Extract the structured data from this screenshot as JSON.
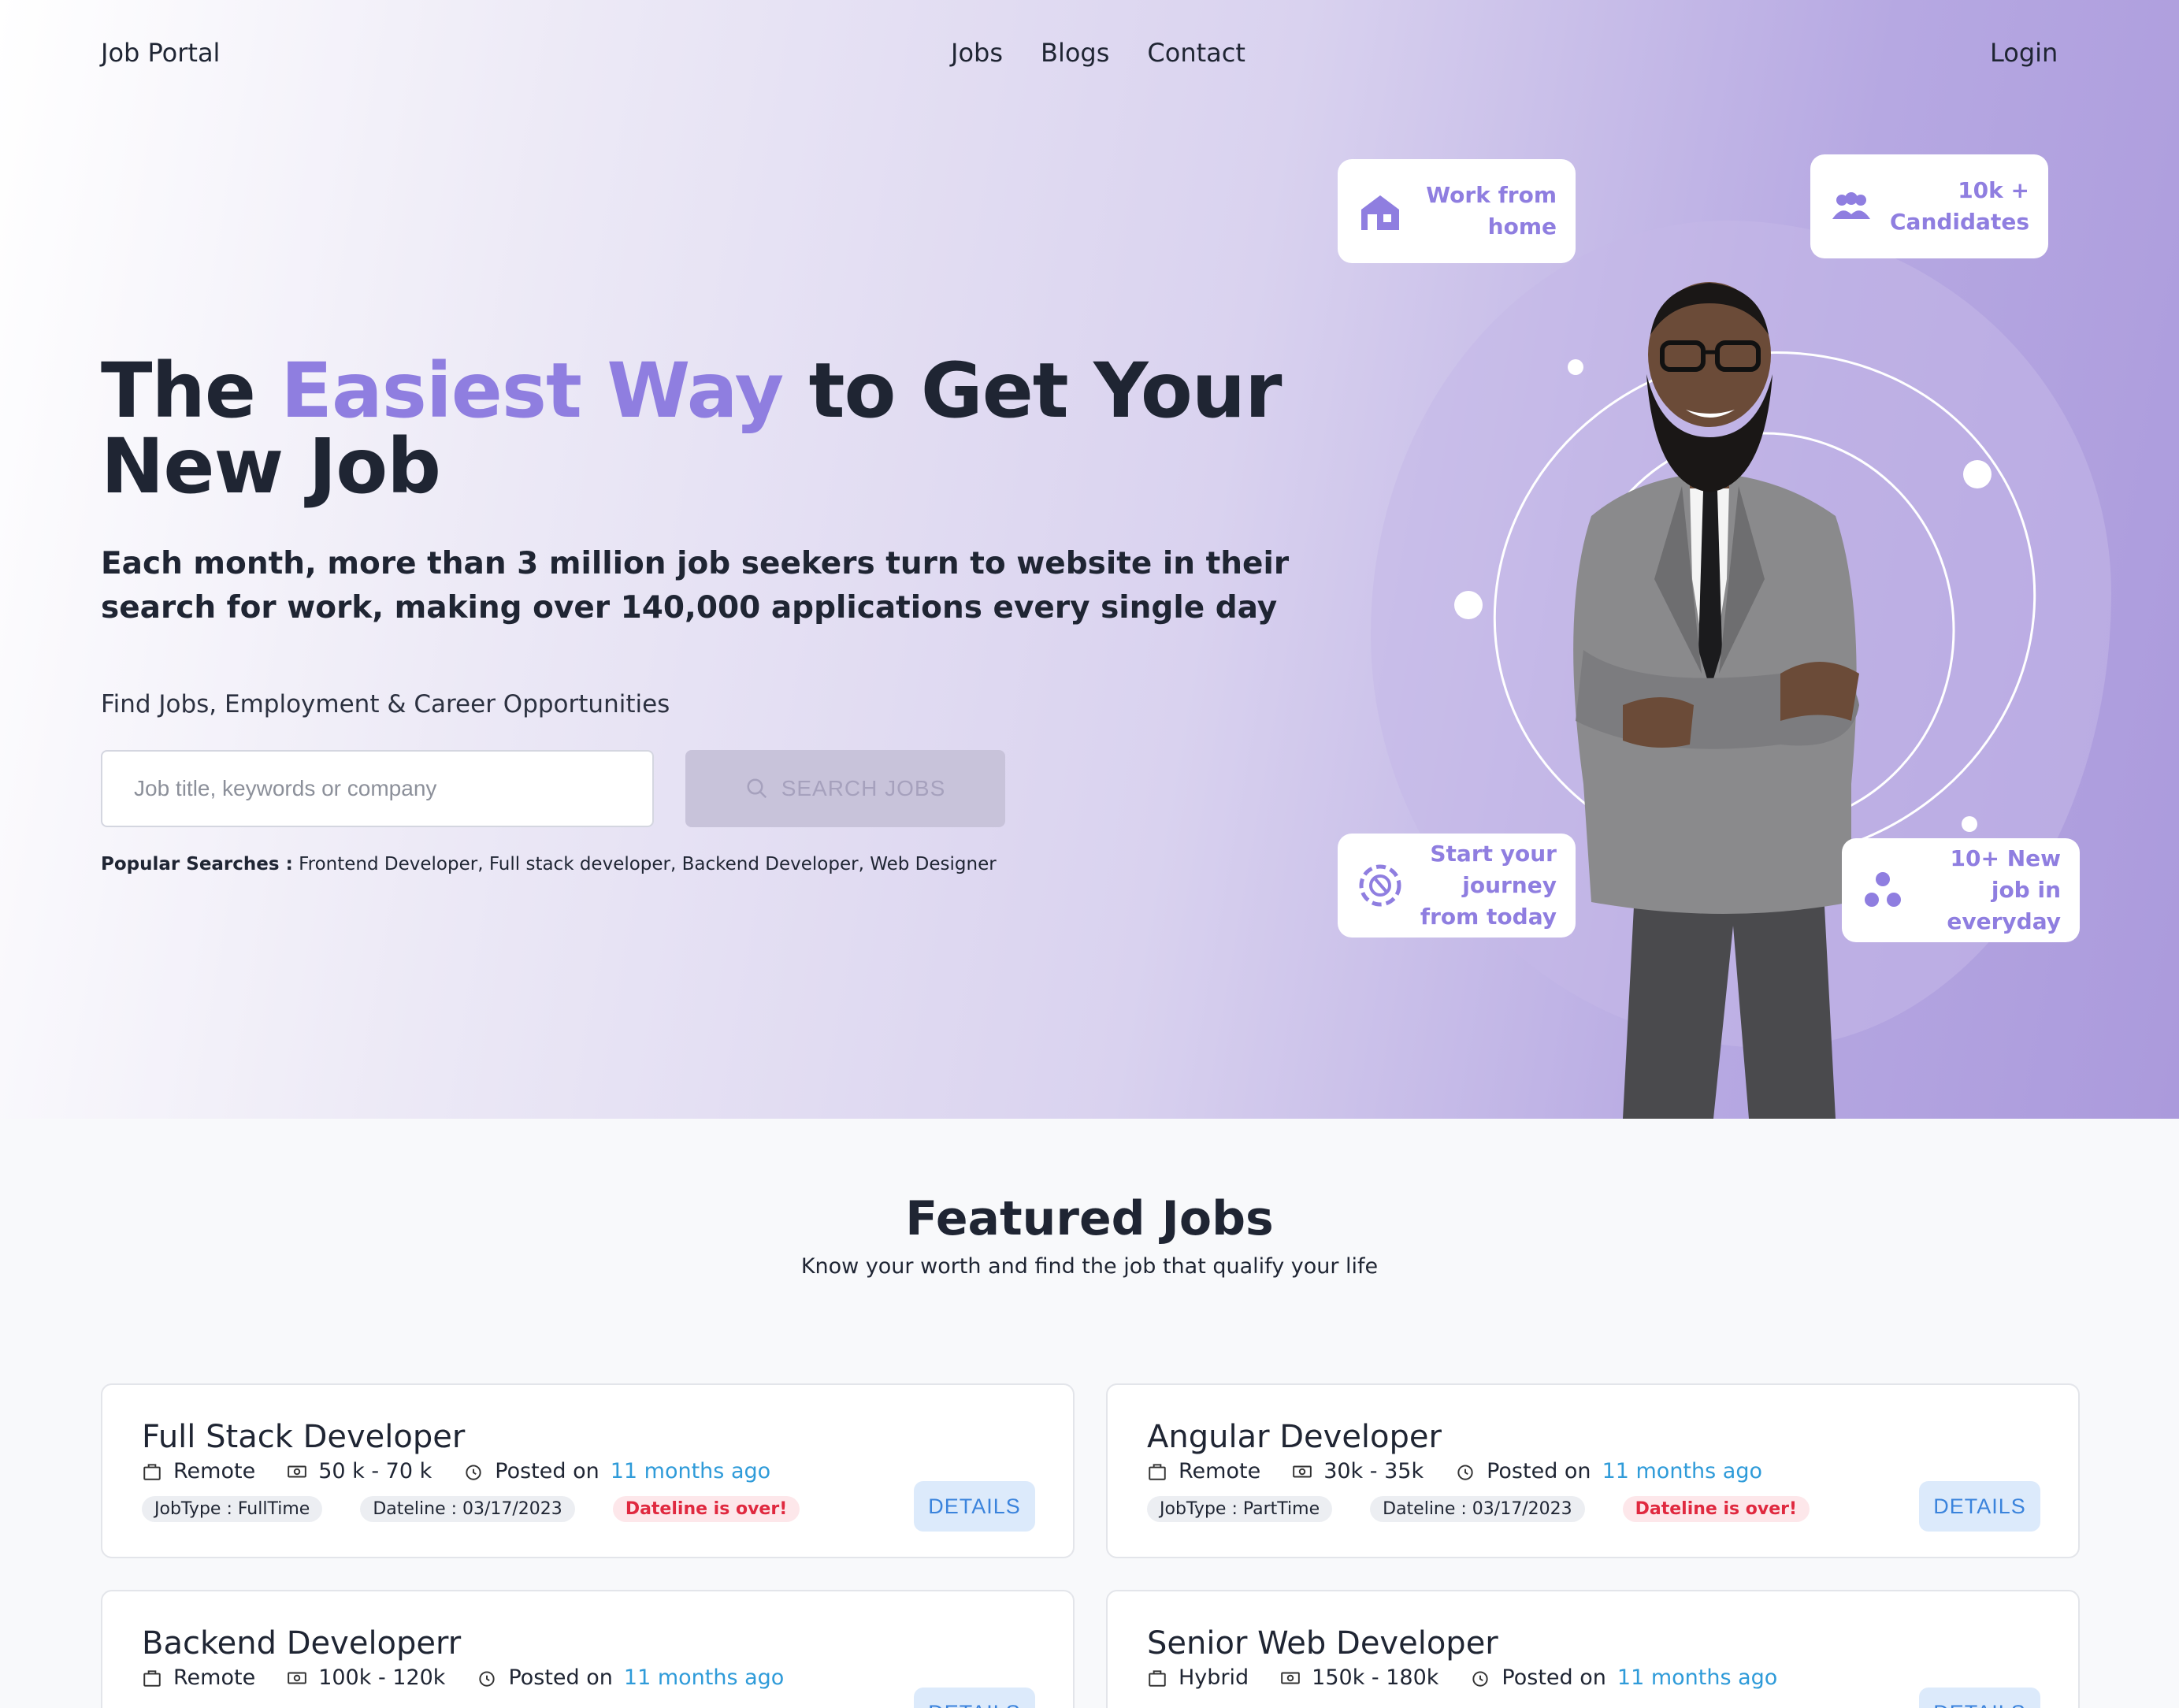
{
  "nav": {
    "brand": "Job Portal",
    "links": [
      "Jobs",
      "Blogs",
      "Contact"
    ],
    "login": "Login"
  },
  "hero": {
    "headline_pre": "The ",
    "headline_accent": "Easiest Way",
    "headline_post": " to Get Your New Job",
    "subhead": "Each month, more than 3 million job seekers turn to website in their search for work, making over 140,000 applications every single day",
    "find_label": "Find Jobs, Employment & Career Opportunities",
    "search_placeholder": "Job title, keywords or company",
    "search_button": "SEARCH JOBS",
    "popular_label": "Popular Searches :",
    "popular_items": " Frontend Developer, Full stack developer, Backend Developer, Web Designer"
  },
  "float_cards": {
    "work_from_home": [
      "Work from",
      "home"
    ],
    "candidates": [
      "10k +",
      "Candidates"
    ],
    "start_journey": [
      "Start your",
      "journey",
      "from today"
    ],
    "new_jobs": [
      "10+ New",
      "job in",
      "everyday"
    ]
  },
  "featured": {
    "title": "Featured Jobs",
    "subtitle": "Know your worth and find the job that qualify your life",
    "details_label": "DETAILS",
    "posted_label": "Posted on",
    "jobs": [
      {
        "title": "Full Stack Developer",
        "location": "Remote",
        "salary": "50 k - 70 k",
        "posted": "11 months ago",
        "job_type": "JobType : FullTime",
        "deadline": "Dateline : 03/17/2023",
        "status": "Dateline is over!"
      },
      {
        "title": "Angular Developer",
        "location": "Remote",
        "salary": "30k - 35k",
        "posted": "11 months ago",
        "job_type": "JobType : PartTime",
        "deadline": "Dateline : 03/17/2023",
        "status": "Dateline is over!"
      },
      {
        "title": "Backend Developerr",
        "location": "Remote",
        "salary": "100k - 120k",
        "posted": "11 months ago",
        "job_type": "",
        "deadline": "",
        "status": ""
      },
      {
        "title": "Senior Web Developer",
        "location": "Hybrid",
        "salary": "150k - 180k",
        "posted": "11 months ago",
        "job_type": "",
        "deadline": "",
        "status": ""
      }
    ]
  },
  "colors": {
    "accent": "#8f7ee0",
    "link_blue": "#2f9bd9",
    "danger_red": "#e0293f",
    "details_bg": "#dceafb",
    "details_text": "#3a83dc"
  },
  "icons": {
    "house": "house-icon",
    "people": "people-icon",
    "compass": "compass-icon",
    "dots": "dots-icon",
    "search": "search-icon",
    "bag": "briefcase-icon",
    "money": "money-icon",
    "clock": "clock-icon"
  }
}
